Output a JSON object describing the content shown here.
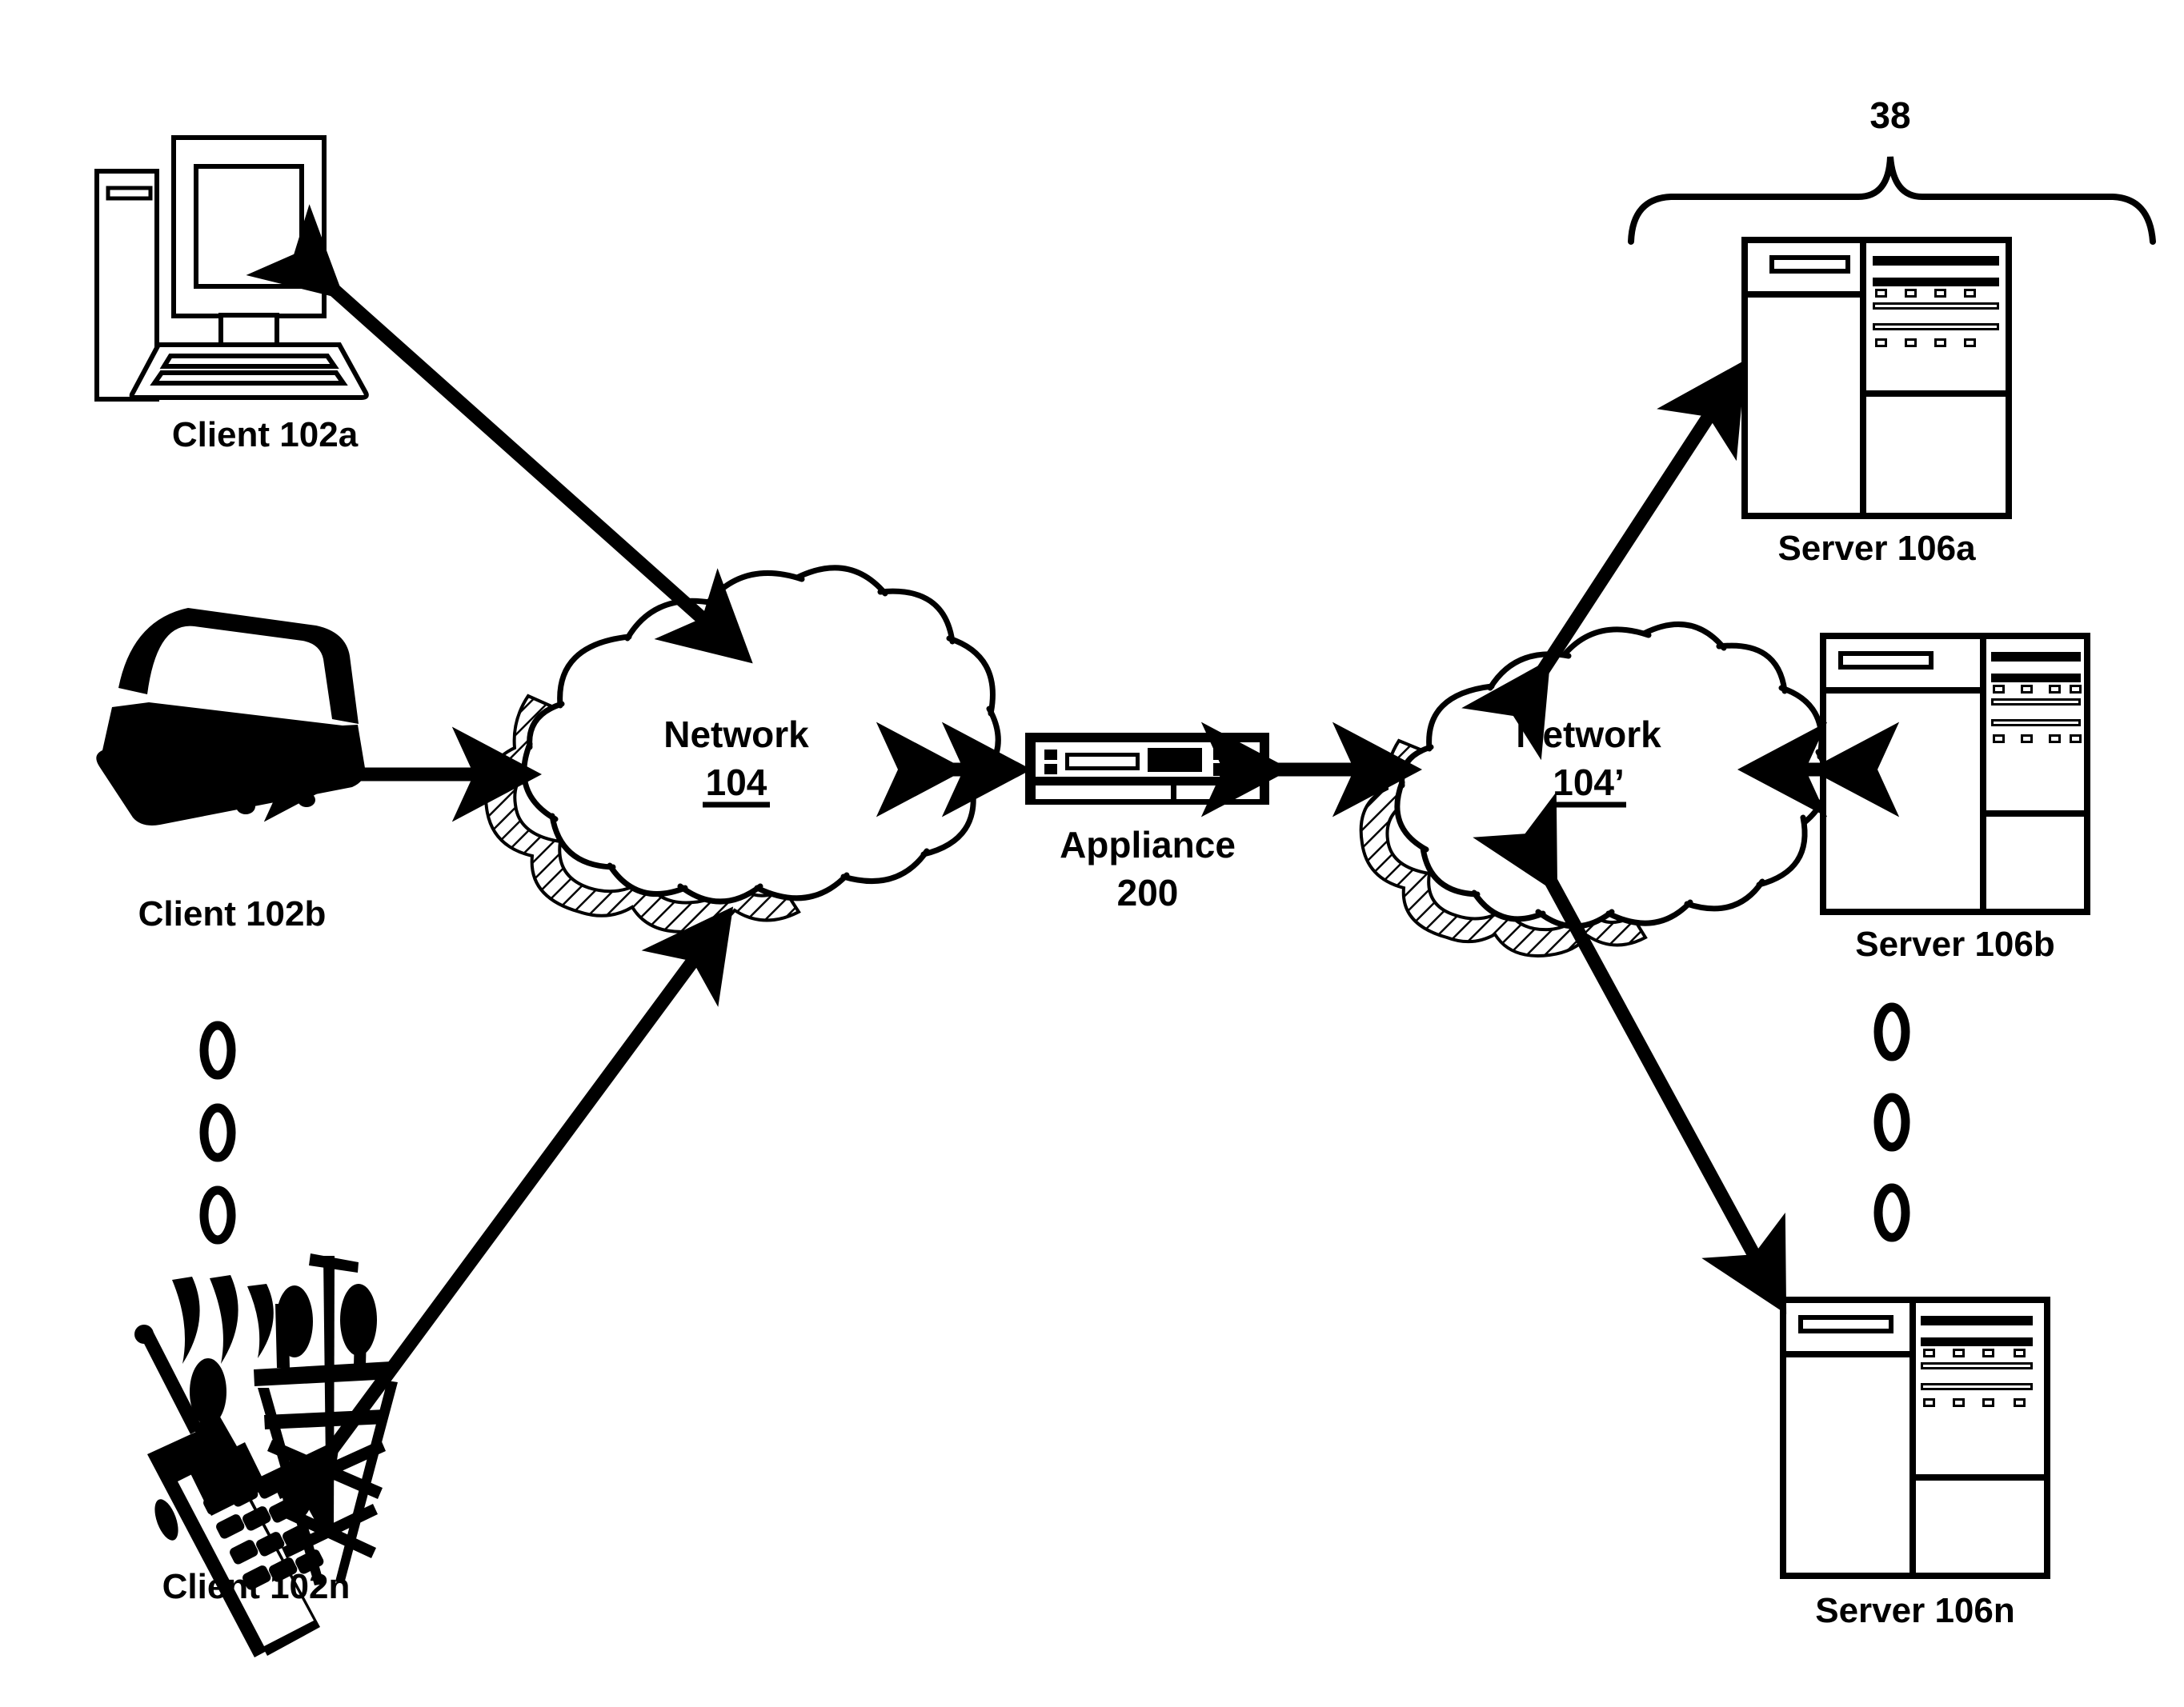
{
  "figure": {
    "type": "patent-network-diagram",
    "background_color": "#ffffff",
    "line_color": "#000000"
  },
  "nodes": {
    "client_a": {
      "label": "Client 102a",
      "icon": "desktop-computer-icon"
    },
    "client_b": {
      "label": "Client 102b",
      "icon": "laptop-computer-icon"
    },
    "client_n": {
      "label": "Client 102n",
      "icon": "mobile-phone-tower-icon"
    },
    "network_left": {
      "label_line1": "Network",
      "label_line2": "104",
      "icon": "cloud-icon"
    },
    "network_right": {
      "label_line1": "Network",
      "label_line2": "104’",
      "icon": "cloud-icon"
    },
    "appliance": {
      "label_line1": "Appliance",
      "label_line2": "200",
      "icon": "rack-appliance-icon"
    },
    "server_a": {
      "label": "Server 106a",
      "icon": "server-rack-icon"
    },
    "server_b": {
      "label": "Server 106b",
      "icon": "server-rack-icon"
    },
    "server_n": {
      "label": "Server 106n",
      "icon": "server-rack-icon"
    }
  },
  "brace": {
    "label": "38"
  },
  "ellipsis": {
    "clients": [
      "○",
      "○",
      "○"
    ],
    "servers": [
      "○",
      "○",
      "○"
    ]
  },
  "connections": [
    {
      "from": "client_a",
      "to": "network_left",
      "style": "double-arrow"
    },
    {
      "from": "client_b",
      "to": "network_left",
      "style": "double-arrow"
    },
    {
      "from": "client_n",
      "to": "network_left",
      "style": "double-arrow"
    },
    {
      "from": "network_left",
      "to": "appliance",
      "style": "double-arrow"
    },
    {
      "from": "appliance",
      "to": "network_right",
      "style": "double-arrow"
    },
    {
      "from": "network_right",
      "to": "server_a",
      "style": "double-arrow"
    },
    {
      "from": "network_right",
      "to": "server_b",
      "style": "double-arrow"
    },
    {
      "from": "network_right",
      "to": "server_n",
      "style": "double-arrow"
    }
  ]
}
